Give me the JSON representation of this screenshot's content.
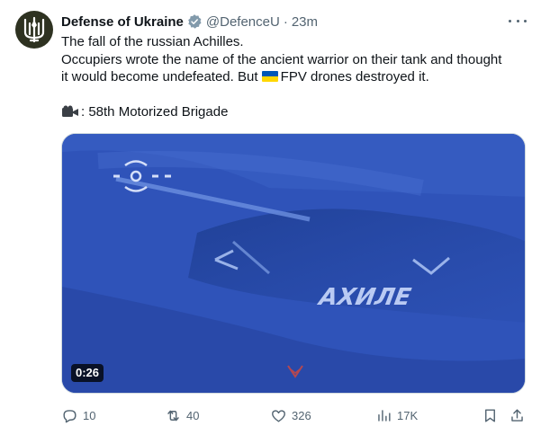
{
  "tweet": {
    "author": {
      "name": "Defense of Ukraine",
      "handle": "@DefenceU",
      "separator": "·",
      "time": "23m",
      "verified": true,
      "avatar_icon": "ukraine-trident-emblem-icon"
    },
    "text": {
      "line1": "The fall of the russian Achilles.",
      "line2": "Occupiers wrote the name of the ancient warrior on their tank and thought",
      "line3_before": "it would become undefeated. But ",
      "line3_after": "FPV drones destroyed it.",
      "credit_icon": "video-camera-icon",
      "credit": ": 58th Motorized Brigade"
    },
    "media": {
      "type": "video",
      "duration": "0:26",
      "overlay_text": "АХИЛЕ"
    },
    "actions": {
      "replies": "10",
      "reposts": "40",
      "likes": "326",
      "views": "17K"
    },
    "colors": {
      "accent": "#1d9bf0",
      "muted": "#536471",
      "flag_blue": "#0057b7",
      "flag_yellow": "#ffd700"
    }
  }
}
